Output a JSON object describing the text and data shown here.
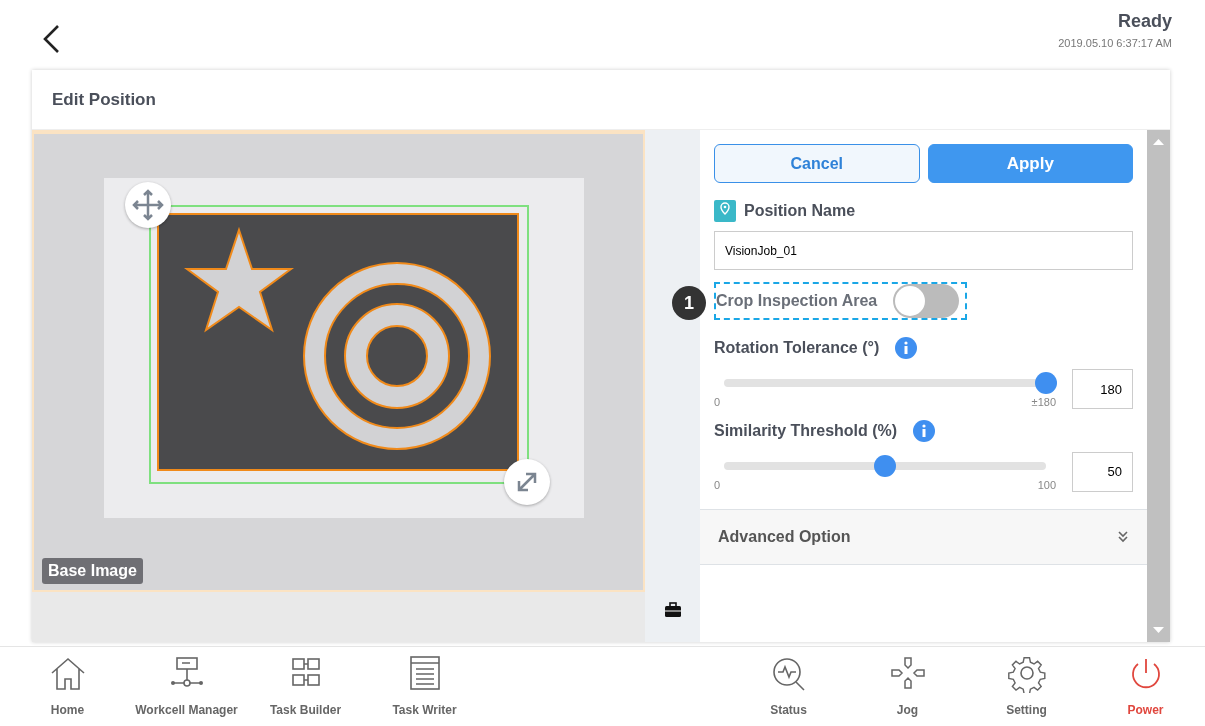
{
  "header": {
    "status": "Ready",
    "datetime": "2019.05.10 6:37:17 AM"
  },
  "panel": {
    "title": "Edit Position",
    "image_label": "Base Image"
  },
  "buttons": [
    {
      "label": "Cancel",
      "kind": "secondary"
    },
    {
      "label": "Apply",
      "kind": "primary"
    }
  ],
  "position_name": {
    "label": "Position Name",
    "value": "VisionJob_01"
  },
  "crop": {
    "label": "Crop Inspection Area",
    "on": false,
    "annotation": "1"
  },
  "sliders": [
    {
      "label": "Rotation Tolerance (°)",
      "level": 1.0,
      "min": "0",
      "max": "±180",
      "value": "180"
    },
    {
      "label": "Similarity Threshold (%)",
      "level": 0.5,
      "min": "0",
      "max": "100",
      "value": "50"
    }
  ],
  "advanced": {
    "label": "Advanced Option",
    "expanded": false
  },
  "nav_left": [
    {
      "label": "Home",
      "kind": "home"
    },
    {
      "label": "Workcell Manager",
      "kind": "workcell"
    },
    {
      "label": "Task Builder",
      "kind": "builder"
    },
    {
      "label": "Task Writer",
      "kind": "writer"
    }
  ],
  "nav_right": [
    {
      "label": "Status",
      "kind": "status"
    },
    {
      "label": "Jog",
      "kind": "jog"
    },
    {
      "label": "Setting",
      "kind": "setting"
    },
    {
      "label": "Power",
      "kind": "power"
    }
  ]
}
